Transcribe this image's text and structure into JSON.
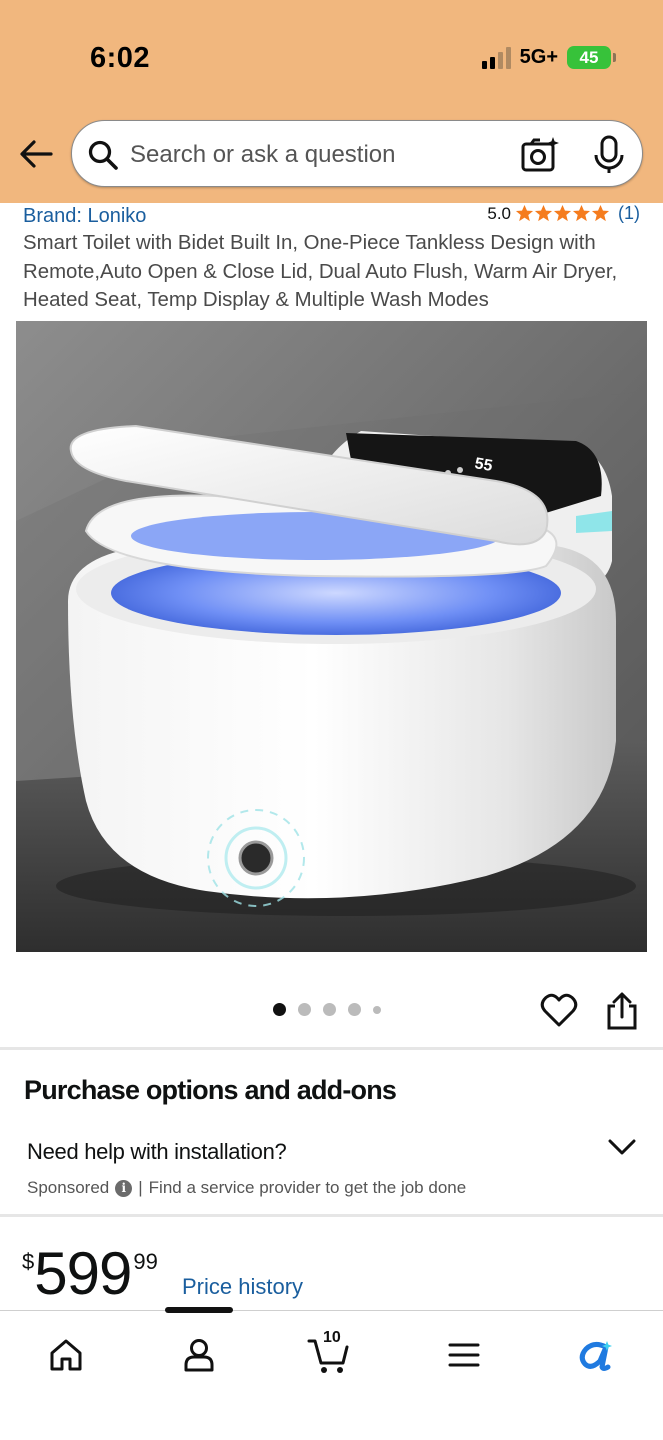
{
  "status_bar": {
    "time": "6:02",
    "network": "5G+",
    "battery": "45"
  },
  "search": {
    "placeholder": "Search or ask a question"
  },
  "product": {
    "brand": "Brand: Loniko",
    "rating_value": "5.0",
    "rating_stars": 5,
    "rating_count": "(1)",
    "title": "Smart Toilet with Bidet Built In, One-Piece Tankless Design with Remote,Auto Open & Close Lid, Dual Auto Flush, Warm Air Dryer, Heated Seat, Temp Display & Multiple Wash Modes",
    "image_display_text": "55",
    "image_count": 5,
    "image_active_index": 0
  },
  "purchase_options": {
    "title": "Purchase options and add-ons",
    "help_title": "Need help with installation?",
    "sponsored": "Sponsored",
    "separator": "|",
    "help_desc": "Find a service provider to get the job done"
  },
  "price": {
    "symbol": "$",
    "whole": "599",
    "fraction": "99",
    "history_link": "Price history"
  },
  "bottom_nav": {
    "items": [
      "home-icon",
      "account-icon",
      "cart-icon",
      "menu-icon",
      "rufus-icon"
    ],
    "cart_count": "10",
    "active_index": 1
  },
  "colors": {
    "header_bg": "#f1b77e",
    "link": "#1a5e9e",
    "star": "#f57c1e",
    "battery": "#37c23a"
  }
}
